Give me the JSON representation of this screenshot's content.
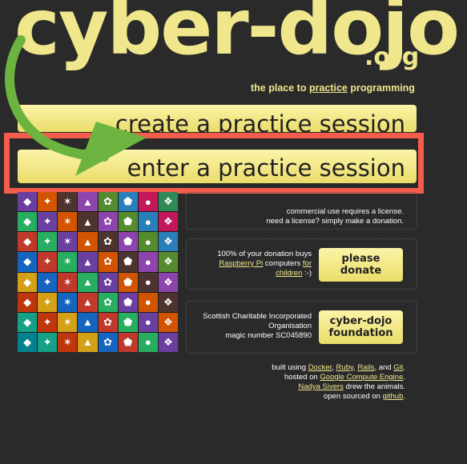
{
  "logo": {
    "main": "cyber-dojo",
    "suffix": ".org"
  },
  "tagline": {
    "before": "the place to ",
    "link": "practice",
    "after": " programming"
  },
  "buttons": {
    "create": "create a practice session",
    "enter": "enter a practice session"
  },
  "annotation": {
    "box_color": "#f45c4b",
    "arrow_color": "#6db33f"
  },
  "accent_color": "#f0e68c",
  "license_panel": {
    "line1": "commercial use requires a license.",
    "line2": "need a license? simply make a donation."
  },
  "donate_panel": {
    "line1": "100% of your donation buys",
    "link1": "Raspberry Pi",
    "line2_mid": " computers ",
    "link2": "for",
    "link3": "children",
    "line3_end": " :-)",
    "button": "please\ndonate"
  },
  "charity_panel": {
    "line1": "Scottish Charitable Incorporated",
    "line2": "Organisation",
    "line3": "magic number SC045890",
    "button": "cyber-dojo\nfoundation"
  },
  "credits": {
    "built_using": "built using ",
    "docker": "Docker",
    "ruby": "Ruby",
    "rails": "Rails",
    "and": "and",
    "git": "Git",
    "hosted_on": "hosted on ",
    "gce": "Google Compute Engine",
    "artist": "Nadya Sivers",
    "drew": " drew the animals.",
    "open_sourced": "open sourced on ",
    "github": "github"
  },
  "animals": {
    "icon_names": [
      "lion",
      "bird",
      "owl",
      "fox",
      "eagle",
      "frog",
      "zebra",
      "panda",
      "cat",
      "whale",
      "toucan",
      "swan",
      "tiger",
      "dolphin",
      "rabbit",
      "penguin"
    ],
    "tile_colors": [
      "#6b3fa0",
      "#2e8b57",
      "#c0392b",
      "#2980b9",
      "#d4a017",
      "#8e44ad",
      "#16a085",
      "#d35400",
      "#7f8c8d",
      "#27ae60",
      "#c2185b",
      "#1565c0",
      "#558b2f",
      "#bf360c",
      "#4e342e",
      "#00838f"
    ]
  }
}
